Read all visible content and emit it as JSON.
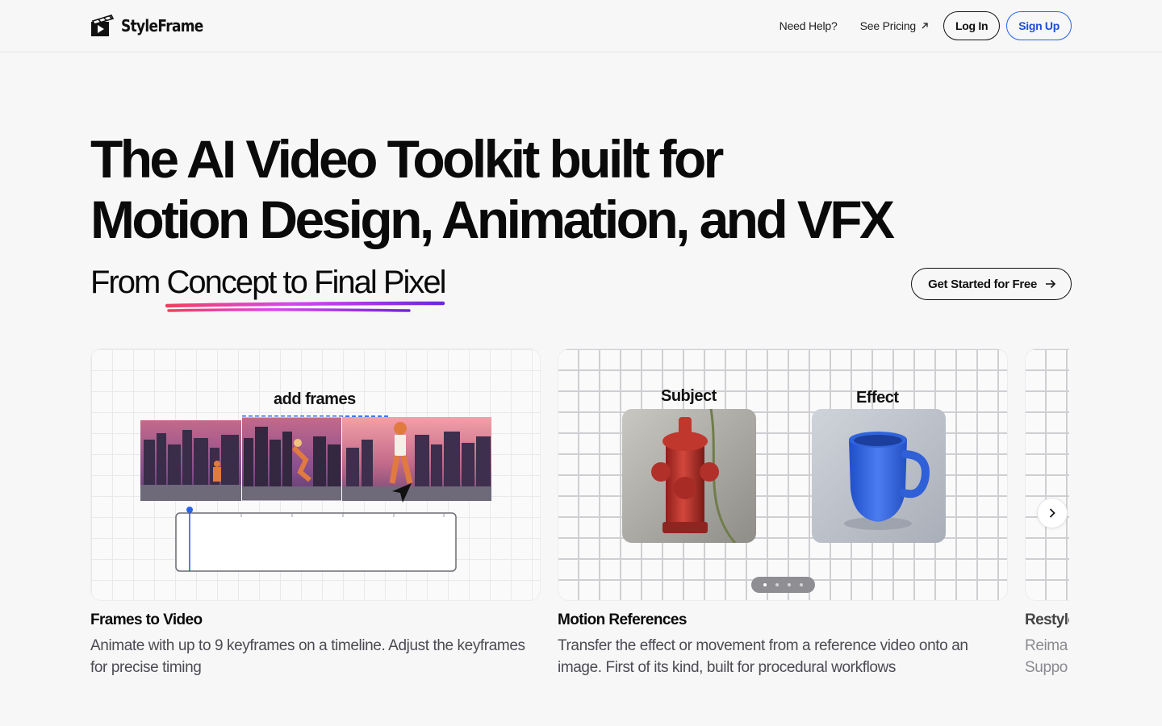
{
  "brand": {
    "name": "StyleFrame"
  },
  "nav": {
    "help": "Need Help?",
    "pricing": "See Pricing",
    "login": "Log In",
    "signup": "Sign Up"
  },
  "hero": {
    "title_line1": "The AI Video Toolkit built for",
    "title_line2": "Motion Design, Animation, and VFX",
    "sub_prefix": "From ",
    "sub_highlight": "Concept to Final Pixel",
    "cta": "Get Started for Free"
  },
  "cards": [
    {
      "title": "Frames to Video",
      "desc": "Animate with up to 9 keyframes on a timeline. Adjust the keyframes for precise timing",
      "media_label": "add frames"
    },
    {
      "title": "Motion References",
      "desc": "Transfer the effect or movement from a reference video onto an image. First of its kind, built for procedural workflows",
      "subject_label": "Subject",
      "effect_label": "Effect",
      "carousel": {
        "total": 4,
        "active": 1
      }
    },
    {
      "title": "Restyle",
      "desc_line1": "Reima",
      "desc_line2": "Suppo"
    }
  ],
  "colors": {
    "accent_blue": "#2563eb",
    "underline_pink": "#ec4899",
    "underline_purple": "#7c3aed"
  },
  "icons": {
    "pricing": "arrow-up-right-icon",
    "cta": "arrow-right-icon",
    "next": "chevron-right-icon"
  }
}
